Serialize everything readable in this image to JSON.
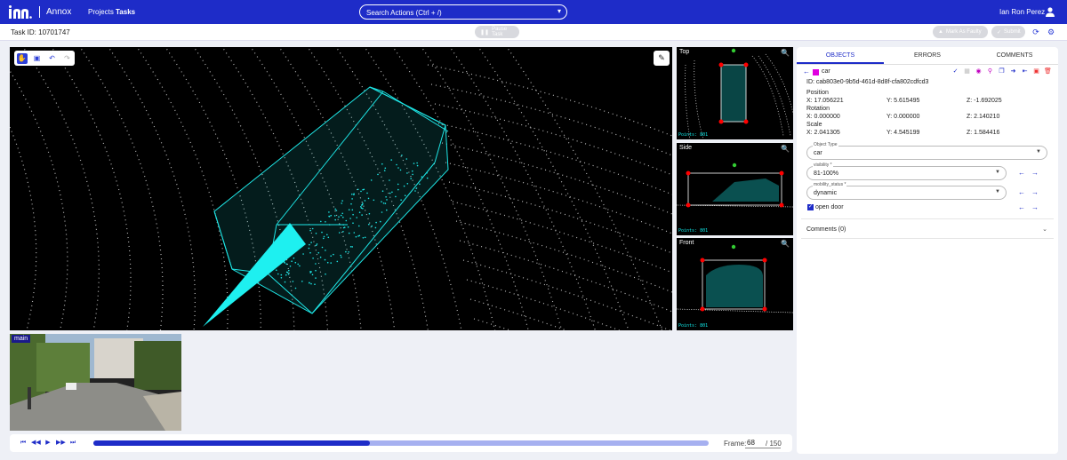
{
  "header": {
    "app_name": "Annox",
    "nav": {
      "projects": "Projects",
      "tasks": "Tasks"
    },
    "search_placeholder": "Search Actions (Ctrl + /)",
    "user_name": "Ian Ron Perez"
  },
  "subbar": {
    "task_id": "Task ID: 10701747",
    "pause_label": "Pause Task",
    "faulty_label": "Mark As Faulty",
    "submit_label": "Submit"
  },
  "viewport": {
    "tools": [
      "hand-icon",
      "box-icon",
      "undo-icon",
      "redo-icon"
    ],
    "settings_icon": "eye-off-icon"
  },
  "views": {
    "top": {
      "label": "Top",
      "points": "Points: 801"
    },
    "side": {
      "label": "Side",
      "points": "Points: 801"
    },
    "front": {
      "label": "Front",
      "points": "Points: 801"
    }
  },
  "camera": {
    "label": "main"
  },
  "timeline": {
    "frame_label": "Frame:",
    "frame_value": "68",
    "frame_total": "/ 150",
    "progress": 0.45
  },
  "panel": {
    "tabs": [
      "OBJECTS",
      "ERRORS",
      "COMMENTS"
    ],
    "object": {
      "name": "car",
      "color": "#e000e0",
      "id_text": "ID: cab803e0-9b5d-461d-8d8f-cfa802cdfcd3",
      "position_label": "Position",
      "position": {
        "x": "X: 17.056221",
        "y": "Y: 5.615495",
        "z": "Z: -1.692025"
      },
      "rotation_label": "Rotation",
      "rotation": {
        "x": "X: 0.000000",
        "y": "Y: 0.000000",
        "z": "Z: 2.140210"
      },
      "scale_label": "Scale",
      "scale": {
        "x": "X: 2.041305",
        "y": "Y: 4.545199",
        "z": "Z: 1.584416"
      }
    },
    "fields": {
      "object_type": {
        "legend": "Object Type",
        "value": "car"
      },
      "visibility": {
        "legend": "visibility *",
        "value": "81-100%"
      },
      "mobility": {
        "legend": "mobility_status *",
        "value": "dynamic"
      },
      "open_door": {
        "label": "open door",
        "checked": true
      }
    },
    "comments_label": "Comments (0)"
  }
}
